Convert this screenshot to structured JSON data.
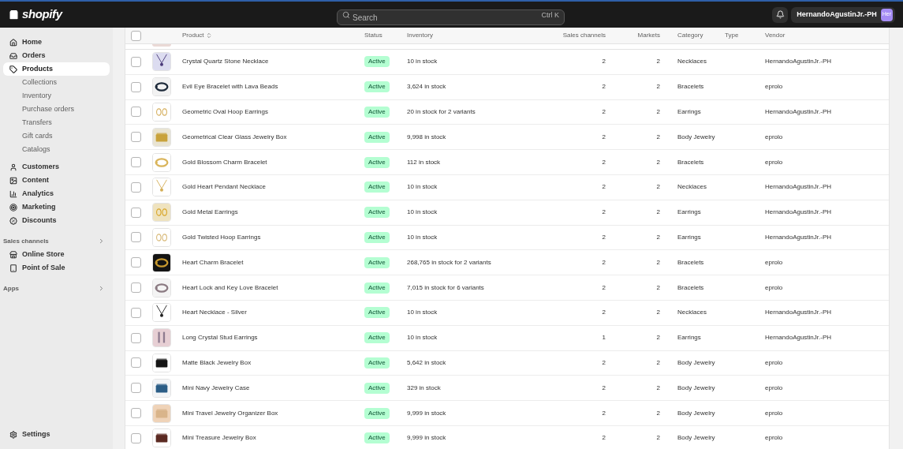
{
  "topbar": {
    "logo": "shopify",
    "search": {
      "placeholder": "Search",
      "shortcut": "Ctrl K"
    },
    "account": {
      "name": "HernandoAgustinJr.-PH",
      "avatar": "Her"
    }
  },
  "sidebar": {
    "items": [
      {
        "label": "Home",
        "selected": false
      },
      {
        "label": "Orders",
        "selected": false
      },
      {
        "label": "Products",
        "selected": true,
        "children": [
          {
            "label": "Collections"
          },
          {
            "label": "Inventory"
          },
          {
            "label": "Purchase orders"
          },
          {
            "label": "Transfers"
          },
          {
            "label": "Gift cards"
          },
          {
            "label": "Catalogs"
          }
        ]
      },
      {
        "label": "Customers",
        "selected": false
      },
      {
        "label": "Content",
        "selected": false
      },
      {
        "label": "Analytics",
        "selected": false
      },
      {
        "label": "Marketing",
        "selected": false
      },
      {
        "label": "Discounts",
        "selected": false
      }
    ],
    "sales_channels": {
      "title": "Sales channels",
      "items": [
        {
          "label": "Online Store"
        },
        {
          "label": "Point of Sale"
        }
      ]
    },
    "apps": {
      "title": "Apps"
    },
    "settings": {
      "label": "Settings"
    }
  },
  "table": {
    "header_checked": false,
    "columns": [
      {
        "label": "Product",
        "sortable": true
      },
      {
        "label": "Status",
        "sortable": false
      },
      {
        "label": "Inventory",
        "sortable": false
      },
      {
        "label": "Sales channels",
        "sortable": false
      },
      {
        "label": "Markets",
        "sortable": false
      },
      {
        "label": "Category",
        "sortable": false
      },
      {
        "label": "Type",
        "sortable": false
      },
      {
        "label": "Vendor",
        "sortable": false
      }
    ],
    "rows": [
      {
        "checked": false,
        "product": "Crystal Quartz Stone Necklace",
        "status": "Active",
        "inventory": "10 in stock",
        "sales_channels": "2",
        "markets": "2",
        "category": "Necklaces",
        "vendor": "HernandoAgustinJr.-PH"
      },
      {
        "checked": false,
        "product": "Evil Eye Bracelet with Lava Beads",
        "status": "Active",
        "inventory": "3,624 in stock",
        "sales_channels": "2",
        "markets": "2",
        "category": "Bracelets",
        "vendor": "eprolo"
      },
      {
        "checked": false,
        "product": "Geometric Oval Hoop Earrings",
        "status": "Active",
        "inventory": "20 in stock for 2 variants",
        "sales_channels": "2",
        "markets": "2",
        "category": "Earrings",
        "vendor": "HernandoAgustinJr.-PH"
      },
      {
        "checked": false,
        "product": "Geometrical Clear Glass Jewelry Box",
        "status": "Active",
        "inventory": "9,998 in stock",
        "sales_channels": "2",
        "markets": "2",
        "category": "Body Jewelry",
        "vendor": "eprolo"
      },
      {
        "checked": false,
        "product": "Gold Blossom Charm Bracelet",
        "status": "Active",
        "inventory": "112 in stock",
        "sales_channels": "2",
        "markets": "2",
        "category": "Bracelets",
        "vendor": "eprolo"
      },
      {
        "checked": false,
        "product": "Gold Heart Pendant Necklace",
        "status": "Active",
        "inventory": "10 in stock",
        "sales_channels": "2",
        "markets": "2",
        "category": "Necklaces",
        "vendor": "HernandoAgustinJr.-PH"
      },
      {
        "checked": false,
        "product": "Gold Metal Earrings",
        "status": "Active",
        "inventory": "10 in stock",
        "sales_channels": "2",
        "markets": "2",
        "category": "Earrings",
        "vendor": "HernandoAgustinJr.-PH"
      },
      {
        "checked": false,
        "product": "Gold Twisted Hoop Earrings",
        "status": "Active",
        "inventory": "10 in stock",
        "sales_channels": "2",
        "markets": "2",
        "category": "Earrings",
        "vendor": "HernandoAgustinJr.-PH"
      },
      {
        "checked": false,
        "product": "Heart Charm Bracelet",
        "status": "Active",
        "inventory": "268,765 in stock for 2 variants",
        "sales_channels": "2",
        "markets": "2",
        "category": "Bracelets",
        "vendor": "eprolo"
      },
      {
        "checked": false,
        "product": "Heart Lock and Key Love Bracelet",
        "status": "Active",
        "inventory": "7,015 in stock for 6 variants",
        "sales_channels": "2",
        "markets": "2",
        "category": "Bracelets",
        "vendor": "eprolo"
      },
      {
        "checked": false,
        "product": "Heart Necklace - Silver",
        "status": "Active",
        "inventory": "10 in stock",
        "sales_channels": "2",
        "markets": "2",
        "category": "Necklaces",
        "vendor": "HernandoAgustinJr.-PH"
      },
      {
        "checked": false,
        "product": "Long Crystal Stud Earrings",
        "status": "Active",
        "inventory": "10 in stock",
        "sales_channels": "1",
        "markets": "2",
        "category": "Earrings",
        "vendor": "HernandoAgustinJr.-PH"
      },
      {
        "checked": false,
        "product": "Matte Black Jewelry Box",
        "status": "Active",
        "inventory": "5,642 in stock",
        "sales_channels": "2",
        "markets": "2",
        "category": "Body Jewelry",
        "vendor": "eprolo"
      },
      {
        "checked": false,
        "product": "Mini Navy Jewelry Case",
        "status": "Active",
        "inventory": "329 in stock",
        "sales_channels": "2",
        "markets": "2",
        "category": "Body Jewelry",
        "vendor": "eprolo"
      },
      {
        "checked": false,
        "product": "Mini Travel Jewelry Organizer Box",
        "status": "Active",
        "inventory": "9,999 in stock",
        "sales_channels": "2",
        "markets": "2",
        "category": "Body Jewelry",
        "vendor": "eprolo"
      },
      {
        "checked": false,
        "product": "Mini Treasure Jewelry Box",
        "status": "Active",
        "inventory": "9,999 in stock",
        "sales_channels": "2",
        "markets": "2",
        "category": "Body Jewelry",
        "vendor": "eprolo"
      }
    ]
  }
}
